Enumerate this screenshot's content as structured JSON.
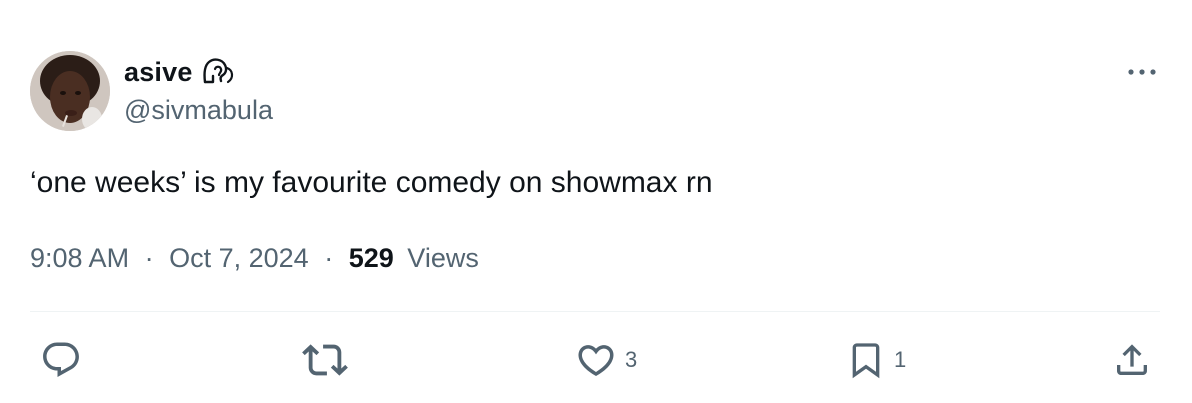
{
  "user": {
    "display_name": "asive",
    "name_emoji": "ear-with-hearing-aid-icon",
    "handle": "@sivmabula"
  },
  "tweet": {
    "text": "‘one weeks’ is my favourite comedy on showmax rn",
    "time": "9:08 AM",
    "separator": "·",
    "date": "Oct 7, 2024",
    "views_count": "529",
    "views_label": "Views"
  },
  "actions": {
    "replies": "",
    "reposts": "",
    "likes": "3",
    "bookmarks": "1"
  },
  "colors": {
    "text_primary": "#0f1419",
    "text_secondary": "#536471",
    "divider": "#eff3f4"
  }
}
